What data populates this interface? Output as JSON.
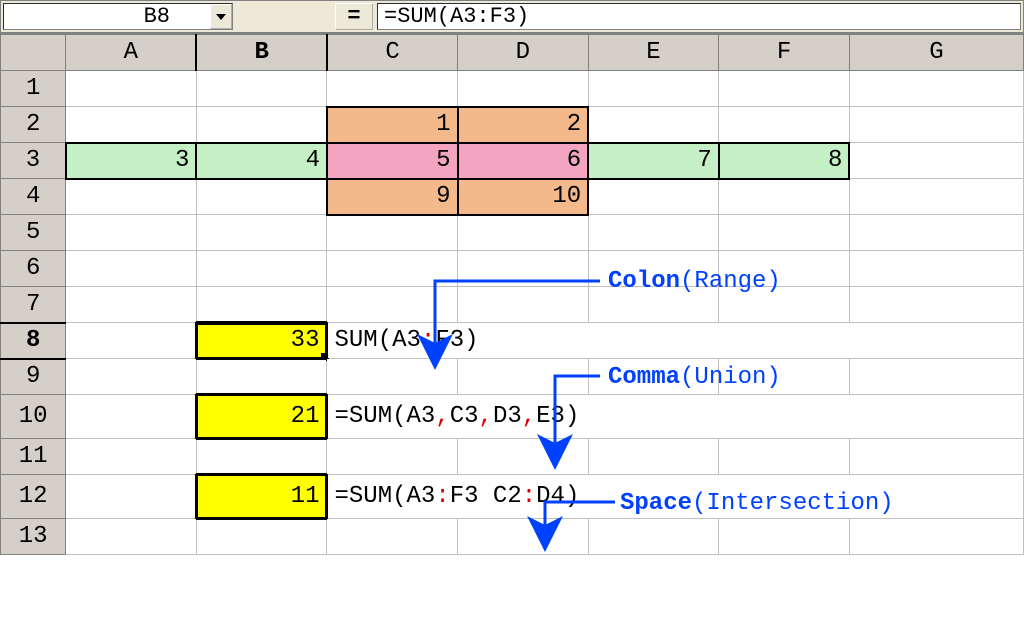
{
  "formula_bar": {
    "cell_ref": "B8",
    "eq_label": "=",
    "formula": "=SUM(A3:F3)"
  },
  "columns": [
    "A",
    "B",
    "C",
    "D",
    "E",
    "F",
    "G"
  ],
  "rows": [
    "1",
    "2",
    "3",
    "4",
    "5",
    "6",
    "7",
    "8",
    "9",
    "10",
    "11",
    "12",
    "13"
  ],
  "selected": {
    "col": "B",
    "row": "8"
  },
  "cells": {
    "C2": "1",
    "D2": "2",
    "A3": "3",
    "B3": "4",
    "C3": "5",
    "D3": "6",
    "E3": "7",
    "F3": "8",
    "C4": "9",
    "D4": "10",
    "B8": "33",
    "B10": "21",
    "B12": "11"
  },
  "formulas": {
    "row8": {
      "pre": "SUM(A3",
      "op": ":",
      "mid": "F3)",
      "rest": ""
    },
    "row10": {
      "text": "=SUM(A3,C3,D3,E3)",
      "pre": "=SUM(A3",
      "c1": ",",
      "p2": "C3",
      "c2": ",",
      "p3": "D3",
      "c3": ",",
      "p4": "E3)"
    },
    "row12": {
      "pre": "=SUM(A3",
      "op1": ":",
      "p2": "F3 C2",
      "op2": ":",
      "p3": "D4)"
    }
  },
  "annotations": {
    "colon": {
      "label": "Colon",
      "paren": "(Range)"
    },
    "comma": {
      "label": "Comma",
      "paren": "(Union)"
    },
    "space": {
      "label": "Space",
      "paren": "(Intersection)"
    }
  },
  "styles": {
    "orange": [
      "C2",
      "D2",
      "C4",
      "D4"
    ],
    "green": [
      "A3",
      "B3",
      "E3",
      "F3"
    ],
    "pink": [
      "C3",
      "D3"
    ],
    "yellow": [
      "B8",
      "B10",
      "B12"
    ]
  }
}
